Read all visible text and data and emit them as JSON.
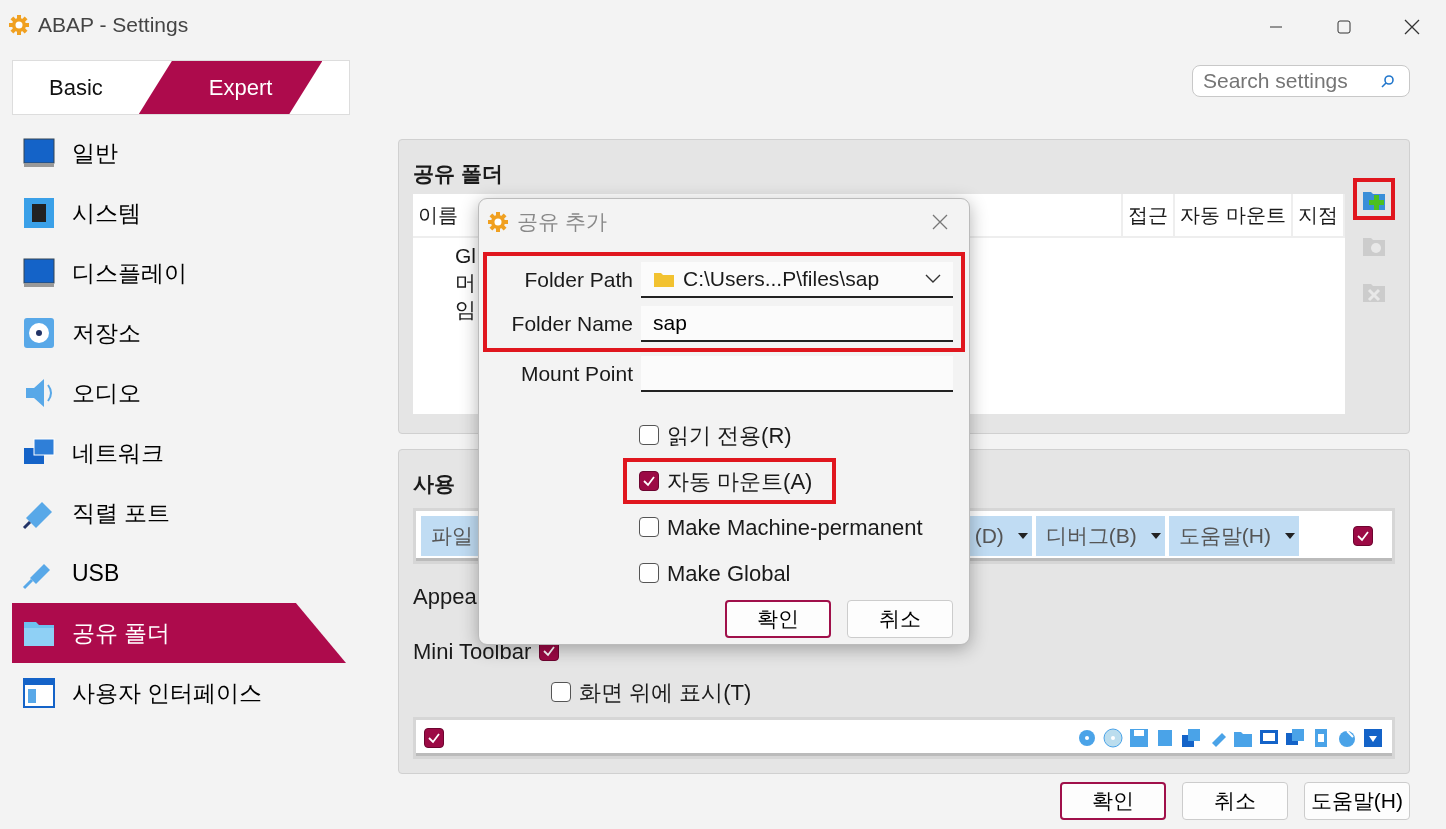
{
  "window": {
    "title": "ABAP - Settings"
  },
  "mode_tabs": [
    {
      "label": "Basic",
      "selected": false
    },
    {
      "label": "Expert",
      "selected": true
    }
  ],
  "search": {
    "placeholder": "Search settings"
  },
  "sidebar": {
    "items": [
      {
        "label": "일반",
        "selected": false
      },
      {
        "label": "시스템",
        "selected": false
      },
      {
        "label": "디스플레이",
        "selected": false
      },
      {
        "label": "저장소",
        "selected": false
      },
      {
        "label": "오디오",
        "selected": false
      },
      {
        "label": "네트워크",
        "selected": false
      },
      {
        "label": "직렬 포트",
        "selected": false
      },
      {
        "label": "USB",
        "selected": false
      },
      {
        "label": "공유 폴더",
        "selected": true
      },
      {
        "label": "사용자 인터페이스",
        "selected": false
      }
    ]
  },
  "shared_folders": {
    "title": "공유 폴더",
    "columns": [
      "이름",
      "접근",
      "자동 마운트",
      "지점"
    ],
    "rows": [
      "Gl",
      "머",
      "임"
    ],
    "tools": [
      {
        "kind": "add",
        "disabled": false,
        "highlighted": true
      },
      {
        "kind": "edit",
        "disabled": true,
        "highlighted": false
      },
      {
        "kind": "remove",
        "disabled": true,
        "highlighted": false
      }
    ]
  },
  "user_interface": {
    "title": "사용",
    "menu_items": [
      "파일",
      "(D)",
      "디버그(B)",
      "도움말(H)"
    ],
    "menu_bar_checked": true,
    "appearance_label": "Appea",
    "mini_toolbar": {
      "label": "Mini Toolbar",
      "checked": true
    },
    "options": [
      {
        "label": "화면 위에 표시(T)",
        "checked": false
      }
    ],
    "status_bar_checked": true
  },
  "buttons": [
    {
      "label": "확인",
      "default": true
    },
    {
      "label": "취소",
      "default": false
    },
    {
      "label": "도움말(H)",
      "default": false
    }
  ],
  "dialog": {
    "title": "공유 추가",
    "fields": [
      {
        "kind": "combo",
        "label": "Folder Path",
        "value": "C:\\Users...P\\files\\sap",
        "highlighted": true
      },
      {
        "kind": "text",
        "label": "Folder Name",
        "value": "sap",
        "highlighted": true
      },
      {
        "kind": "text",
        "label": "Mount Point",
        "highlighted": false
      }
    ],
    "checkboxes": [
      {
        "label": "읽기 전용(R)",
        "checked": false,
        "highlighted": false
      },
      {
        "label": "자동 마운트(A)",
        "checked": true,
        "highlighted": true
      },
      {
        "label": "Make Machine-permanent",
        "checked": false,
        "highlighted": false
      },
      {
        "label": "Make Global",
        "checked": false,
        "highlighted": false
      }
    ],
    "buttons": [
      {
        "label": "확인",
        "default": true
      },
      {
        "label": "취소",
        "default": false
      }
    ]
  }
}
